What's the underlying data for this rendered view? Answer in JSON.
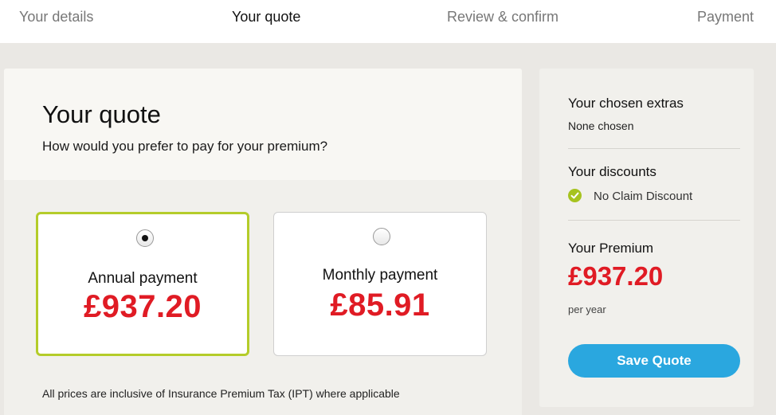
{
  "steps": [
    {
      "label": "Your details",
      "active": false
    },
    {
      "label": "Your quote",
      "active": true
    },
    {
      "label": "Review & confirm",
      "active": false
    },
    {
      "label": "Payment",
      "active": false
    }
  ],
  "quote": {
    "title": "Your quote",
    "subtitle": "How would you prefer to pay for your premium?",
    "options": [
      {
        "label": "Annual payment",
        "price": "£937.20",
        "selected": true
      },
      {
        "label": "Monthly payment",
        "price": "£85.91",
        "selected": false
      }
    ],
    "footnote": "All prices are inclusive of Insurance Premium Tax (IPT) where applicable"
  },
  "summary": {
    "extras_title": "Your chosen extras",
    "extras_value": "None chosen",
    "discounts_title": "Your discounts",
    "discounts": [
      "No Claim Discount"
    ],
    "premium_title": "Your Premium",
    "premium_price": "£937.20",
    "premium_period": "per year",
    "save_button": "Save Quote"
  },
  "colors": {
    "price_red": "#e01b24",
    "selected_border": "#b4cc2a",
    "button_blue": "#2aa7df",
    "check_green": "#a6c31f"
  },
  "icons": {
    "radio_selected": "radio-selected-icon",
    "radio_unselected": "radio-unselected-icon",
    "discount_check": "check-circle-icon"
  }
}
